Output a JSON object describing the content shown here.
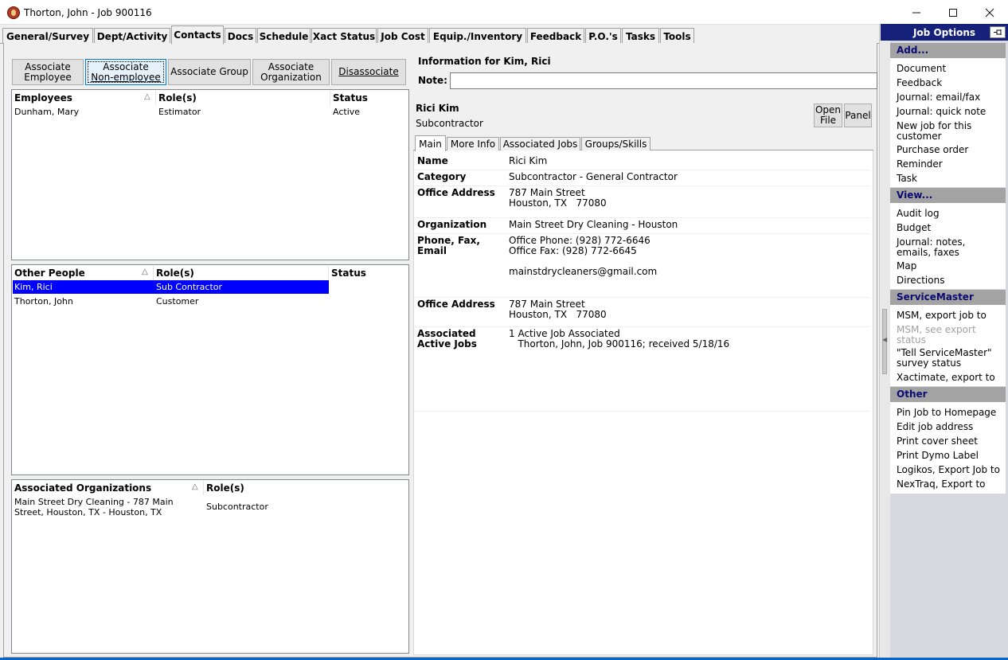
{
  "window": {
    "title": "Thorton, John - Job 900116",
    "minimize_icon": "minimize-icon",
    "maximize_icon": "maximize-icon",
    "close_icon": "close-icon"
  },
  "tabs": [
    {
      "label": "General/Survey"
    },
    {
      "label": "Dept/Activity"
    },
    {
      "label": "Contacts",
      "active": true
    },
    {
      "label": "Docs"
    },
    {
      "label": "Schedule"
    },
    {
      "label": "Xact Status"
    },
    {
      "label": "Job Cost"
    },
    {
      "label": "Equip./Inventory"
    },
    {
      "label": "Feedback"
    },
    {
      "label": "P.O.'s"
    },
    {
      "label": "Tasks"
    },
    {
      "label": "Tools"
    }
  ],
  "associate_buttons": [
    {
      "line1": "Associate",
      "line2": "Employee"
    },
    {
      "line1": "Associate",
      "line2": "Non-employee"
    },
    {
      "line1": "Associate Group",
      "line2": ""
    },
    {
      "line1": "Associate",
      "line2": "Organization"
    },
    {
      "line1": "Disassociate",
      "line2": ""
    }
  ],
  "employees": {
    "headers": [
      "Employees",
      "Role(s)",
      "Status"
    ],
    "rows": [
      {
        "name": "Dunham, Mary",
        "role": "Estimator",
        "status": "Active"
      }
    ]
  },
  "other_people": {
    "headers": [
      "Other People",
      "Role(s)",
      "Status"
    ],
    "rows": [
      {
        "name": "Kim, Rici",
        "role": "Sub Contractor",
        "status": "",
        "selected": true
      },
      {
        "name": "Thorton, John",
        "role": "Customer",
        "status": ""
      }
    ]
  },
  "organizations": {
    "headers": [
      "Associated Organizations",
      "Role(s)"
    ],
    "rows": [
      {
        "name_line1": "Main Street Dry Cleaning - 787 Main",
        "name_line2": "Street, Houston, TX - Houston, TX",
        "role": "Subcontractor"
      }
    ]
  },
  "info": {
    "title": "Information for Kim, Rici",
    "note_label": "Note:",
    "note_value": "",
    "contact_name": "Rici Kim",
    "contact_category": "Subcontractor",
    "open_file_line1": "Open",
    "open_file_line2": "File",
    "panel_label": "Panel",
    "subtabs": [
      "Main",
      "More Info",
      "Associated Jobs",
      "Groups/Skills"
    ],
    "details": [
      {
        "label": "Name",
        "value": "Rici Kim"
      },
      {
        "label": "Category",
        "value": "Subcontractor - General Contractor"
      },
      {
        "label": "Office Address",
        "value": "787 Main Street\nHouston, TX   77080"
      },
      {
        "label": "Organization",
        "value": "Main Street Dry Cleaning - Houston"
      },
      {
        "label": "Phone, Fax,\nEmail",
        "value": "Office Phone: (928) 772-6646\nOffice Fax: (928) 772-6645\n\nmainstdrycleaners@gmail.com"
      },
      {
        "label": "Office Address",
        "value": "787 Main Street\nHouston, TX   77080"
      },
      {
        "label": "Associated\nActive Jobs",
        "value": "1 Active Job Associated\n   Thorton, John, Job 900116; received 5/18/16"
      }
    ]
  },
  "job_options": {
    "title": "Job Options",
    "pin_icon": "pin-icon",
    "sections": [
      {
        "title": "Add...",
        "items": [
          {
            "label": "Document"
          },
          {
            "label": "Feedback"
          },
          {
            "label": "Journal: email/fax"
          },
          {
            "label": "Journal: quick note"
          },
          {
            "label": "New job for this customer"
          },
          {
            "label": "Purchase order"
          },
          {
            "label": "Reminder"
          },
          {
            "label": "Task"
          }
        ]
      },
      {
        "title": "View...",
        "items": [
          {
            "label": "Audit log"
          },
          {
            "label": "Budget"
          },
          {
            "label": "Journal: notes, emails, faxes"
          },
          {
            "label": "Map"
          },
          {
            "label": "Directions"
          }
        ]
      },
      {
        "title": "ServiceMaster",
        "items": [
          {
            "label": "MSM, export job to"
          },
          {
            "label": "MSM, see export status",
            "disabled": true
          },
          {
            "label": "\"Tell ServiceMaster\" survey status"
          },
          {
            "label": "Xactimate, export to"
          }
        ]
      },
      {
        "title": "Other",
        "items": [
          {
            "label": "Pin Job to Homepage"
          },
          {
            "label": "Edit job address"
          },
          {
            "label": "Print cover sheet"
          },
          {
            "label": "Print Dymo Label"
          },
          {
            "label": "Logikos, Export Job to"
          },
          {
            "label": "NexTraq, Export to"
          }
        ]
      }
    ]
  }
}
